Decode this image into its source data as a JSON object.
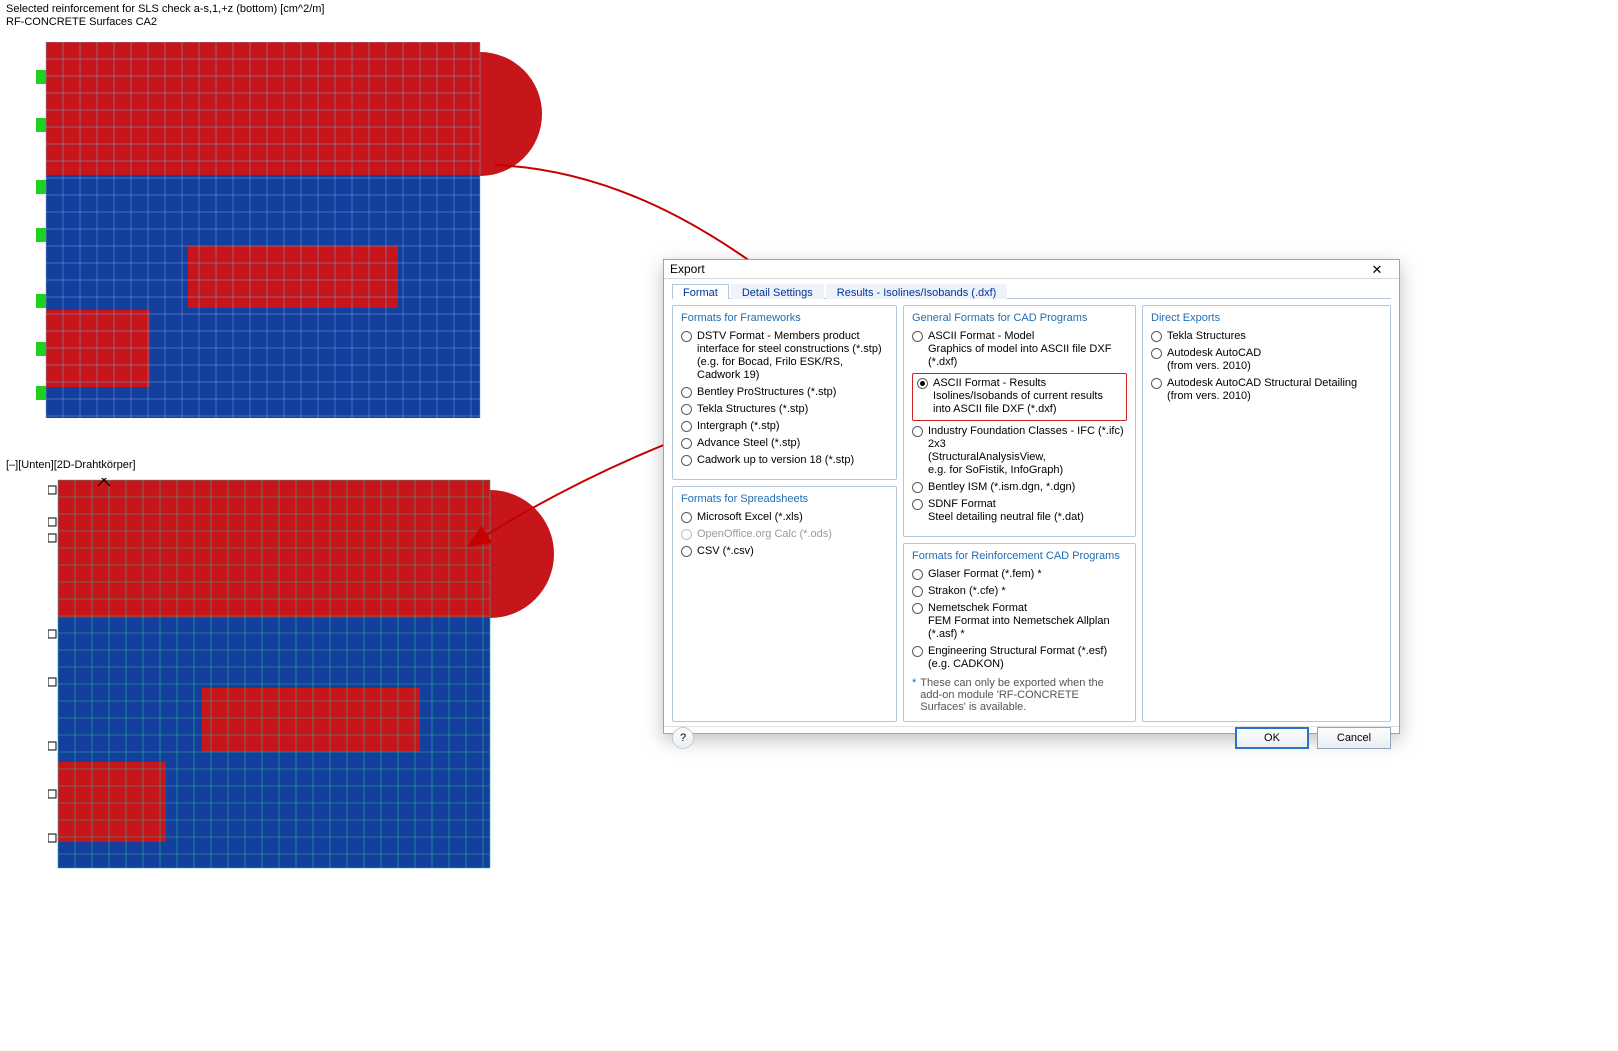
{
  "figure1": {
    "title_line1": "Selected reinforcement for SLS check a-s,1,+z (bottom) [cm^2/m]",
    "title_line2": "RF-CONCRETE Surfaces CA2"
  },
  "figure2": {
    "caption": "[–][Unten][2D-Drahtkörper]"
  },
  "dialog": {
    "title": "Export",
    "close_glyph": "✕",
    "tabs": {
      "format": "Format",
      "detail": "Detail Settings",
      "results": "Results - Isolines/Isobands (.dxf)"
    },
    "groups": {
      "frameworks": {
        "title": "Formats for Frameworks",
        "dstv": {
          "label": "DSTV Format - Members product interface for steel constructions (*.stp)",
          "sub": "(e.g. for Bocad, Frilo ESK/RS, Cadwork 19)"
        },
        "bentley_ps": "Bentley ProStructures (*.stp)",
        "tekla_stp": "Tekla Structures (*.stp)",
        "intergraph": "Intergraph (*.stp)",
        "advance": "Advance Steel (*.stp)",
        "cadwork": "Cadwork up to version 18 (*.stp)"
      },
      "spreadsheets": {
        "title": "Formats for Spreadsheets",
        "excel": "Microsoft Excel (*.xls)",
        "ooo": "OpenOffice.org Calc (*.ods)",
        "csv": "CSV (*.csv)"
      },
      "cad": {
        "title": "General Formats for CAD Programs",
        "ascii_model": {
          "label": "ASCII Format - Model",
          "sub": "Graphics of model into ASCII file DXF (*.dxf)"
        },
        "ascii_results": {
          "label": "ASCII Format - Results",
          "sub": "Isolines/Isobands of current results into ASCII file DXF (*.dxf)"
        },
        "ifc": {
          "label": "Industry Foundation Classes - IFC (*.ifc) 2x3",
          "sub1": "(StructuralAnalysisView,",
          "sub2": "e.g. for SoFistik, InfoGraph)"
        },
        "bentley_ism": "Bentley ISM (*.ism.dgn, *.dgn)",
        "sdnf": {
          "label": "SDNF Format",
          "sub": "Steel detailing neutral file (*.dat)"
        }
      },
      "reinf": {
        "title": "Formats for Reinforcement CAD Programs",
        "glaser": "Glaser Format  (*.fem)  *",
        "strakon": "Strakon (*.cfe)  *",
        "nemetschek": {
          "label": "Nemetschek Format",
          "sub": "FEM Format into Nemetschek Allplan (*.asf)  *"
        },
        "esf": {
          "label": "Engineering Structural Format (*.esf)",
          "sub": "(e.g. CADKON)"
        },
        "note": "These can only be exported when the add-on module 'RF-CONCRETE Surfaces' is available."
      },
      "direct": {
        "title": "Direct Exports",
        "tekla": "Tekla Structures",
        "acad": {
          "label": "Autodesk AutoCAD",
          "sub": "(from vers. 2010)"
        },
        "acad_sd": {
          "label": "Autodesk AutoCAD Structural Detailing",
          "sub": "(from vers. 2010)"
        }
      }
    },
    "help_glyph": "?",
    "ok": "OK",
    "cancel": "Cancel"
  }
}
